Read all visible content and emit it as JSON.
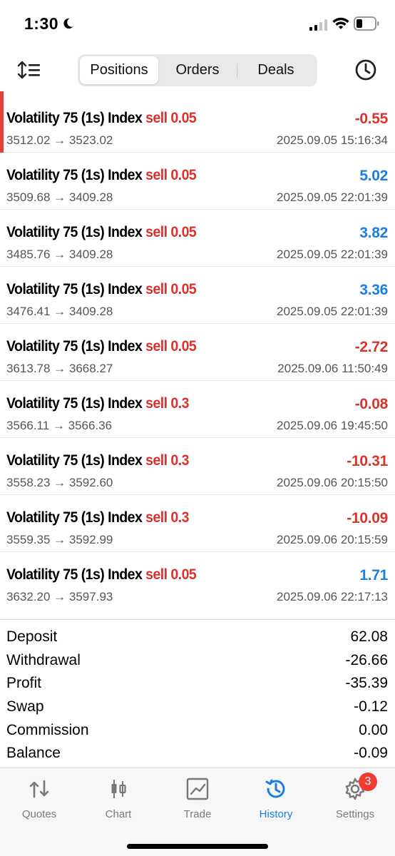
{
  "status_bar": {
    "time": "1:30"
  },
  "toolbar": {
    "tabs": [
      {
        "label": "Positions",
        "active": true
      },
      {
        "label": "Orders",
        "active": false
      },
      {
        "label": "Deals",
        "active": false
      }
    ]
  },
  "deals": [
    {
      "symbol": "Volatility 75 (1s) Index",
      "type": "sell 0.05",
      "profit": "-0.55",
      "prices": "3512.02 → 3523.02",
      "time": "2025.09.05 15:16:34"
    },
    {
      "symbol": "Volatility 75 (1s) Index",
      "type": "sell 0.05",
      "profit": "5.02",
      "prices": "3509.68 → 3409.28",
      "time": "2025.09.05 22:01:39"
    },
    {
      "symbol": "Volatility 75 (1s) Index",
      "type": "sell 0.05",
      "profit": "3.82",
      "prices": "3485.76 → 3409.28",
      "time": "2025.09.05 22:01:39"
    },
    {
      "symbol": "Volatility 75 (1s) Index",
      "type": "sell 0.05",
      "profit": "3.36",
      "prices": "3476.41 → 3409.28",
      "time": "2025.09.05 22:01:39"
    },
    {
      "symbol": "Volatility 75 (1s) Index",
      "type": "sell 0.05",
      "profit": "-2.72",
      "prices": "3613.78 → 3668.27",
      "time": "2025.09.06 11:50:49"
    },
    {
      "symbol": "Volatility 75 (1s) Index",
      "type": "sell 0.3",
      "profit": "-0.08",
      "prices": "3566.11 → 3566.36",
      "time": "2025.09.06 19:45:50"
    },
    {
      "symbol": "Volatility 75 (1s) Index",
      "type": "sell 0.3",
      "profit": "-10.31",
      "prices": "3558.23 → 3592.60",
      "time": "2025.09.06 20:15:50"
    },
    {
      "symbol": "Volatility 75 (1s) Index",
      "type": "sell 0.3",
      "profit": "-10.09",
      "prices": "3559.35 → 3592.99",
      "time": "2025.09.06 20:15:59"
    },
    {
      "symbol": "Volatility 75 (1s) Index",
      "type": "sell 0.05",
      "profit": "1.71",
      "prices": "3632.20 → 3597.93",
      "time": "2025.09.06 22:17:13"
    }
  ],
  "summary": [
    {
      "label": "Deposit",
      "value": "62.08"
    },
    {
      "label": "Withdrawal",
      "value": "-26.66"
    },
    {
      "label": "Profit",
      "value": "-35.39"
    },
    {
      "label": "Swap",
      "value": "-0.12"
    },
    {
      "label": "Commission",
      "value": "0.00"
    },
    {
      "label": "Balance",
      "value": "-0.09"
    }
  ],
  "tabbar": {
    "items": [
      {
        "label": "Quotes",
        "icon": "quotes-icon",
        "active": false
      },
      {
        "label": "Chart",
        "icon": "chart-icon",
        "active": false
      },
      {
        "label": "Trade",
        "icon": "trade-icon",
        "active": false
      },
      {
        "label": "History",
        "icon": "history-icon",
        "active": true
      },
      {
        "label": "Settings",
        "icon": "settings-icon",
        "active": false,
        "badge": "3"
      }
    ]
  },
  "colors": {
    "loss": "#d9342b",
    "gain": "#1a7ee6",
    "accent": "#1a7ee6",
    "badge": "#f23b30"
  }
}
